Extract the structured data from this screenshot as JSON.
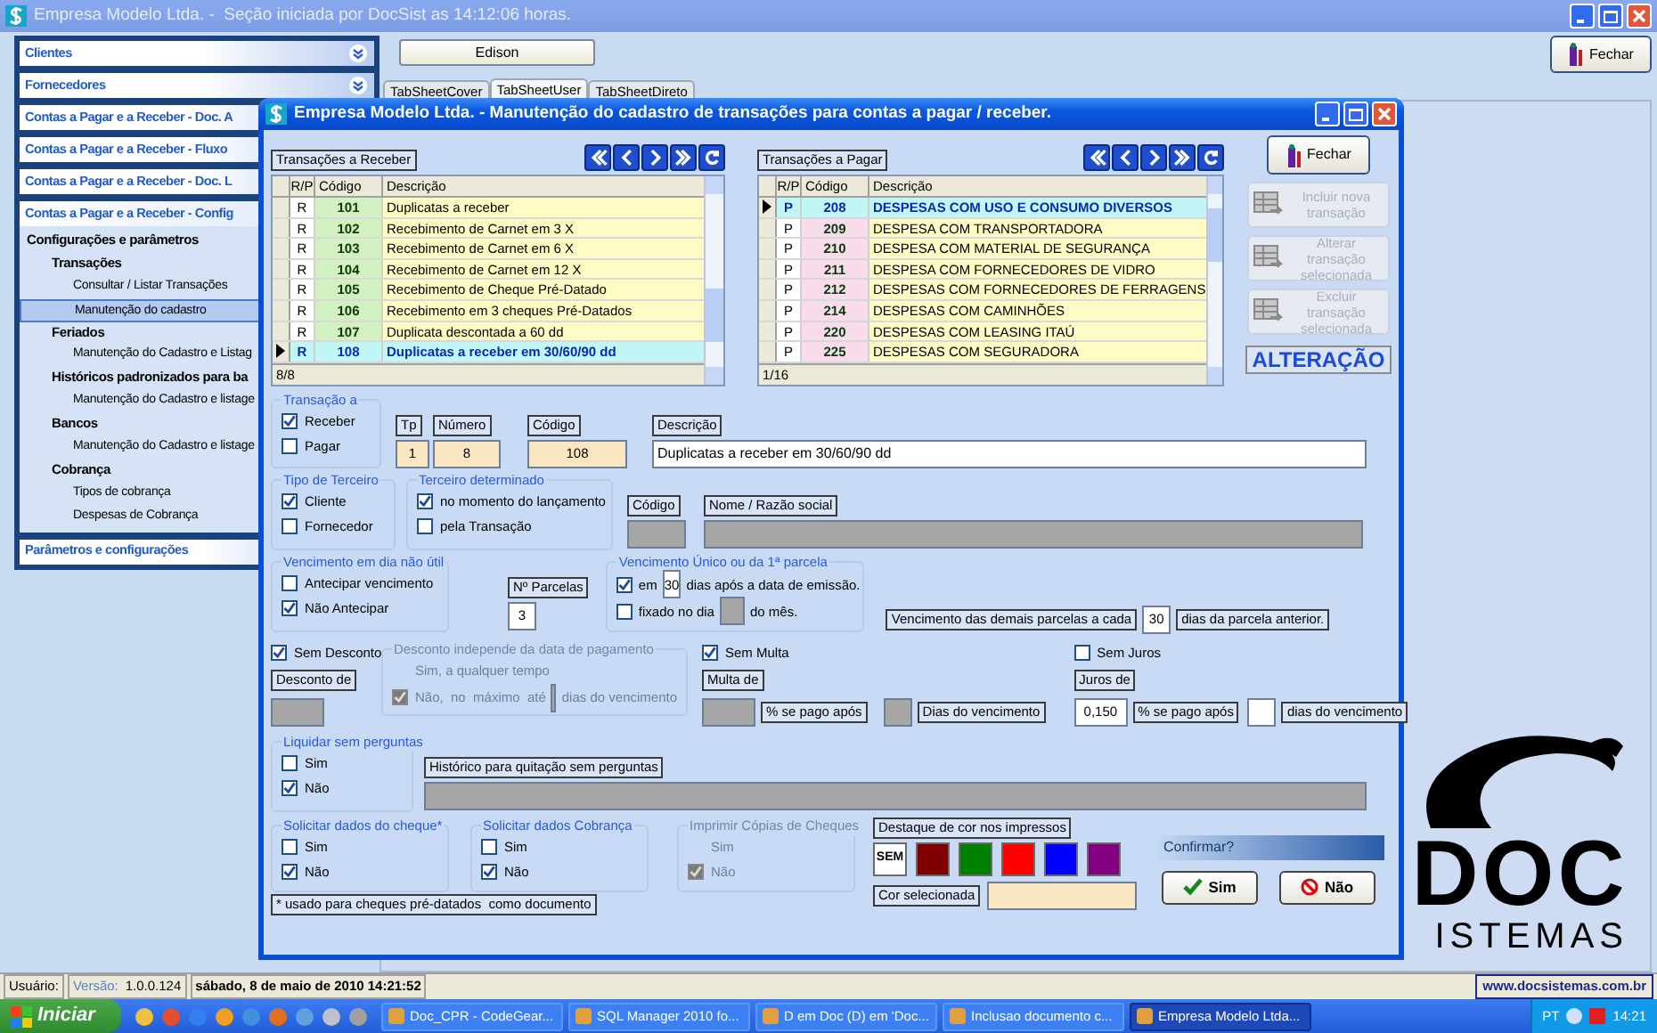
{
  "window": {
    "title": "Empresa Modelo Ltda. -  Seção iniciada por DocSist as 14:12:06 horas."
  },
  "sidebar": {
    "sections": [
      {
        "label": "Clientes",
        "expanded": false
      },
      {
        "label": "Fornecedores",
        "expanded": false
      },
      {
        "label": "Contas a Pagar e a Receber - Doc. A",
        "expanded": false
      },
      {
        "label": "Contas a Pagar e a Receber - Fluxo",
        "expanded": false
      },
      {
        "label": "Contas a Pagar e a Receber - Doc. L",
        "expanded": false
      },
      {
        "label": "Contas a Pagar e a Receber - Config",
        "expanded": true,
        "children": [
          {
            "label": "Configurações e parâmetros",
            "children": [
              {
                "label": "Transações",
                "children": [
                  {
                    "label": "Consultar / Listar Transações",
                    "selected": false
                  },
                  {
                    "label": "Manutenção do cadastro",
                    "selected": true
                  }
                ]
              },
              {
                "label": "Feriados",
                "children": [
                  {
                    "label": "Manutenção do Cadastro e Listag",
                    "selected": false
                  }
                ]
              },
              {
                "label": "Históricos padronizados para ba",
                "children": [
                  {
                    "label": "Manutenção do Cadastro e listage",
                    "selected": false
                  }
                ]
              },
              {
                "label": "Bancos",
                "children": [
                  {
                    "label": "Manutenção do Cadastro e listage",
                    "selected": false
                  }
                ]
              },
              {
                "label": "Cobrança",
                "children": [
                  {
                    "label": "Tipos de cobrança",
                    "selected": false
                  },
                  {
                    "label": "Despesas de Cobrança",
                    "selected": false
                  }
                ]
              }
            ]
          }
        ]
      },
      {
        "label": "Parâmetros e configurações",
        "expanded": false
      }
    ]
  },
  "top_bar": {
    "user_button": "Edison",
    "close_button": "Fechar",
    "tabs": [
      {
        "label": "TabSheetCover",
        "selected": false
      },
      {
        "label": "TabSheetUser",
        "selected": true
      },
      {
        "label": "TabSheetDireto",
        "selected": false
      }
    ]
  },
  "logo": {
    "word": "DOC",
    "tagline": "ISTEMAS"
  },
  "dialog": {
    "title": "Empresa Modelo Ltda. - Manutenção do cadastro de transações para contas a pagar / receber.",
    "tables": [
      {
        "label": "Transações a Receber",
        "columns": [
          "R/P",
          "Código",
          "Descrição"
        ],
        "footer": "8/8",
        "kind": "receber",
        "rows": [
          {
            "rp": "R",
            "code": "101",
            "description": "Duplicatas a receber",
            "selected": false
          },
          {
            "rp": "R",
            "code": "102",
            "description": "Recebimento de Carnet em 3 X",
            "selected": false
          },
          {
            "rp": "R",
            "code": "103",
            "description": "Recebimento de Carnet em 6 X",
            "selected": false
          },
          {
            "rp": "R",
            "code": "104",
            "description": "Recebimento de Carnet em 12 X",
            "selected": false
          },
          {
            "rp": "R",
            "code": "105",
            "description": "Recebimento de Cheque Pré-Datado",
            "selected": false
          },
          {
            "rp": "R",
            "code": "106",
            "description": "Recebimento em 3 cheques Pré-Datados",
            "selected": false
          },
          {
            "rp": "R",
            "code": "107",
            "description": "Duplicata descontada a 60 dd",
            "selected": false
          },
          {
            "rp": "R",
            "code": "108",
            "description": "Duplicatas a receber em 30/60/90 dd",
            "selected": true
          }
        ]
      },
      {
        "label": "Transações a Pagar",
        "columns": [
          "R/P",
          "Código",
          "Descrição"
        ],
        "footer": "1/16",
        "kind": "pagar",
        "rows": [
          {
            "rp": "P",
            "code": "208",
            "description": "DESPESAS COM USO E CONSUMO DIVERSOS",
            "selected": true
          },
          {
            "rp": "P",
            "code": "209",
            "description": "DESPESA COM TRANSPORTADORA",
            "selected": false
          },
          {
            "rp": "P",
            "code": "210",
            "description": "DESPESA COM MATERIAL DE SEGURANÇA",
            "selected": false
          },
          {
            "rp": "P",
            "code": "211",
            "description": "DESPESA COM FORNECEDORES DE VIDRO",
            "selected": false
          },
          {
            "rp": "P",
            "code": "212",
            "description": "DESPESAS COM FORNECEDORES DE FERRAGENS",
            "selected": false
          },
          {
            "rp": "P",
            "code": "214",
            "description": "DESPESAS COM CAMINHÕES",
            "selected": false
          },
          {
            "rp": "P",
            "code": "220",
            "description": "DESPESAS COM LEASING ITAÚ",
            "selected": false
          },
          {
            "rp": "P",
            "code": "225",
            "description": "DESPESAS COM SEGURADORA",
            "selected": false
          }
        ]
      }
    ],
    "close_button": "Fechar",
    "actions": [
      {
        "label": "Incluir nova transação",
        "disabled": true
      },
      {
        "label": "Alterar transação selecionada",
        "disabled": true
      },
      {
        "label": "Excluir transação selecionada",
        "disabled": true
      }
    ],
    "mode": "ALTERAÇÃO",
    "transacao_a": {
      "title": "Transação a",
      "options": [
        {
          "label": "Receber",
          "checked": true
        },
        {
          "label": "Pagar",
          "checked": false
        }
      ]
    },
    "ident_fields": [
      {
        "label": "Tp",
        "value": "1",
        "readonly": true
      },
      {
        "label": "Número",
        "value": "8",
        "readonly": true
      },
      {
        "label": "Código",
        "value": "108",
        "readonly": true
      }
    ],
    "descricao": {
      "label": "Descrição",
      "value": "Duplicatas a receber em 30/60/90 dd"
    },
    "tipo_terceiro": {
      "title": "Tipo de Terceiro",
      "options": [
        {
          "label": "Cliente",
          "checked": true
        },
        {
          "label": "Fornecedor",
          "checked": false
        }
      ]
    },
    "terceiro_determinado": {
      "title": "Terceiro determinado",
      "options": [
        {
          "label": "no momento do lançamento",
          "checked": true
        },
        {
          "label": "pela Transação",
          "checked": false
        }
      ]
    },
    "terceiro_codigo": {
      "label": "Código",
      "disabled": true
    },
    "terceiro_nome": {
      "label": "Nome / Razão social",
      "disabled": true
    },
    "vencimento_nao_util": {
      "title": "Vencimento em dia não útil",
      "options": [
        {
          "label": "Antecipar vencimento",
          "checked": false
        },
        {
          "label": "Não Antecipar",
          "checked": true
        }
      ]
    },
    "parcelas": {
      "label": "Nº Parcelas",
      "value": "3"
    },
    "vencimento_unico": {
      "title": "Vencimento Único ou da 1ª parcela",
      "rows": [
        {
          "label": "em",
          "checked": true,
          "value": "30",
          "disabled": false,
          "suffix": "dias após a data de emissão."
        },
        {
          "label": "fixado no dia",
          "checked": false,
          "disabled": true,
          "suffix": "do mês."
        }
      ]
    },
    "demais_parcelas": {
      "label": "Vencimento das demais parcelas a cada",
      "value": "30",
      "suffix": "dias da parcela anterior."
    },
    "desconto": {
      "toggle": {
        "label": "Sem Desconto",
        "checked": true
      },
      "field": {
        "label": "Desconto de",
        "disabled": true
      },
      "group": {
        "title": "Desconto independe da data de pagamento",
        "disabled": true,
        "options": [
          {
            "label": "Sim, a qualquer tempo",
            "checked": false
          },
          {
            "label": "Não,  no  máximo  até",
            "checked": true
          }
        ],
        "suffix": "dias do vencimento"
      }
    },
    "multa": {
      "toggle": {
        "label": "Sem Multa",
        "checked": true
      },
      "field": {
        "label": "Multa de",
        "disabled": true
      },
      "after_label": "% se pago após",
      "days_disabled": true,
      "days_label": "Dias do vencimento"
    },
    "juros": {
      "toggle": {
        "label": "Sem Juros",
        "checked": false
      },
      "field": {
        "label": "Juros de",
        "value": "0,150",
        "disabled": false
      },
      "after_label": "% se pago após",
      "days_disabled": false,
      "days_label": "dias do vencimento"
    },
    "liquidar": {
      "title": "Liquidar sem perguntas",
      "options": [
        {
          "label": "Sim",
          "checked": false
        },
        {
          "label": "Não",
          "checked": true
        }
      ]
    },
    "historico": {
      "label": "Histórico para quitação sem perguntas",
      "disabled": true
    },
    "cheque_groups": [
      {
        "title": "Solicitar dados do cheque*",
        "disabled": false,
        "options": [
          {
            "label": "Sim",
            "checked": false
          },
          {
            "label": "Não",
            "checked": true
          }
        ]
      },
      {
        "title": "Solicitar dados Cobrança",
        "disabled": false,
        "options": [
          {
            "label": "Sim",
            "checked": false
          },
          {
            "label": "Não",
            "checked": true
          }
        ]
      },
      {
        "title": "Imprimir Cópias de Cheques",
        "disabled": true,
        "options": [
          {
            "label": "Sim",
            "checked": false
          },
          {
            "label": "Não",
            "checked": true
          }
        ]
      }
    ],
    "cheque_note": "* usado para cheques pré-datados  como documento",
    "destaque": {
      "label": "Destaque de cor nos impressos",
      "swatches": [
        {
          "kind": "none",
          "label": "SEM"
        },
        {
          "kind": "color",
          "color": "#800000"
        },
        {
          "kind": "color",
          "color": "#008000"
        },
        {
          "kind": "color",
          "color": "#ff0000"
        },
        {
          "kind": "color",
          "color": "#0000ff"
        },
        {
          "kind": "color",
          "color": "#800080"
        }
      ],
      "selected_label": "Cor selecionada"
    },
    "confirm": {
      "title": "Confirmar?",
      "buttons": [
        {
          "kind": "yes",
          "label": "Sim"
        },
        {
          "kind": "no",
          "label": "Não"
        }
      ]
    }
  },
  "status_bar": {
    "user_label": "Usuário:",
    "version_label": "Versão:",
    "version": "1.0.0.124",
    "datetime": "sábado, 8 de maio de 2010 14:21:52",
    "website": "www.docsistemas.com.br"
  },
  "taskbar": {
    "start": "Iniciar",
    "tasks": [
      {
        "label": "Doc_CPR - CodeGear...",
        "selected": false
      },
      {
        "label": "SQL Manager 2010 fo...",
        "selected": false
      },
      {
        "label": "D em Doc (D) em 'Doc...",
        "selected": false
      },
      {
        "label": "Inclusao documento c...",
        "selected": false
      },
      {
        "label": "Empresa Modelo Ltda...",
        "selected": true
      }
    ],
    "language": "PT",
    "clock": "14:21"
  }
}
